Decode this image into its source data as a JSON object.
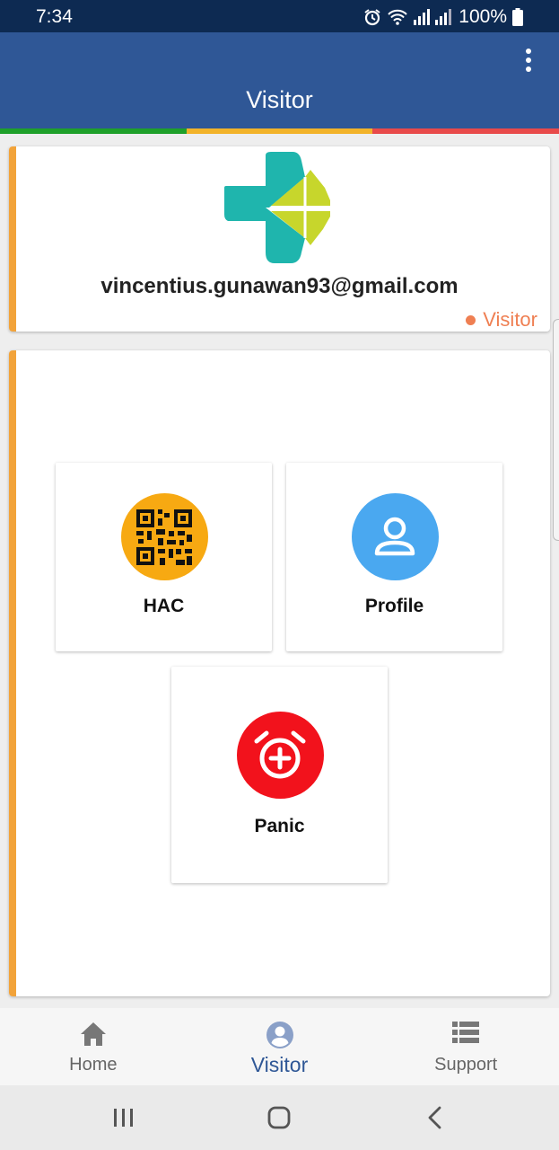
{
  "status_bar": {
    "time": "7:34",
    "battery": "100%",
    "icons": [
      "alarm-icon",
      "wifi-icon",
      "signal-icon",
      "battery-icon"
    ]
  },
  "app_bar": {
    "title": "Visitor",
    "menu_icon": "more-vert-icon"
  },
  "stripe_colors": [
    "#1ea02a",
    "#f2b32a",
    "#e84a4a"
  ],
  "user": {
    "email": "vincentius.gunawan93@gmail.com",
    "role": "Visitor",
    "logo": "kemenkes-logo"
  },
  "menu": {
    "tiles": [
      {
        "label": "HAC",
        "icon": "qr-code-icon",
        "color": "#f7a912"
      },
      {
        "label": "Profile",
        "icon": "person-icon",
        "color": "#4aa8f0"
      },
      {
        "label": "Panic",
        "icon": "alarm-add-icon",
        "color": "#f2121c"
      }
    ]
  },
  "bottom_nav": {
    "items": [
      {
        "label": "Home",
        "icon": "home-icon"
      },
      {
        "label": "Visitor",
        "icon": "account-circle-icon",
        "active": true
      },
      {
        "label": "Support",
        "icon": "list-icon"
      }
    ]
  },
  "system_nav": [
    "recents-icon",
    "home-circle-icon",
    "back-icon"
  ]
}
